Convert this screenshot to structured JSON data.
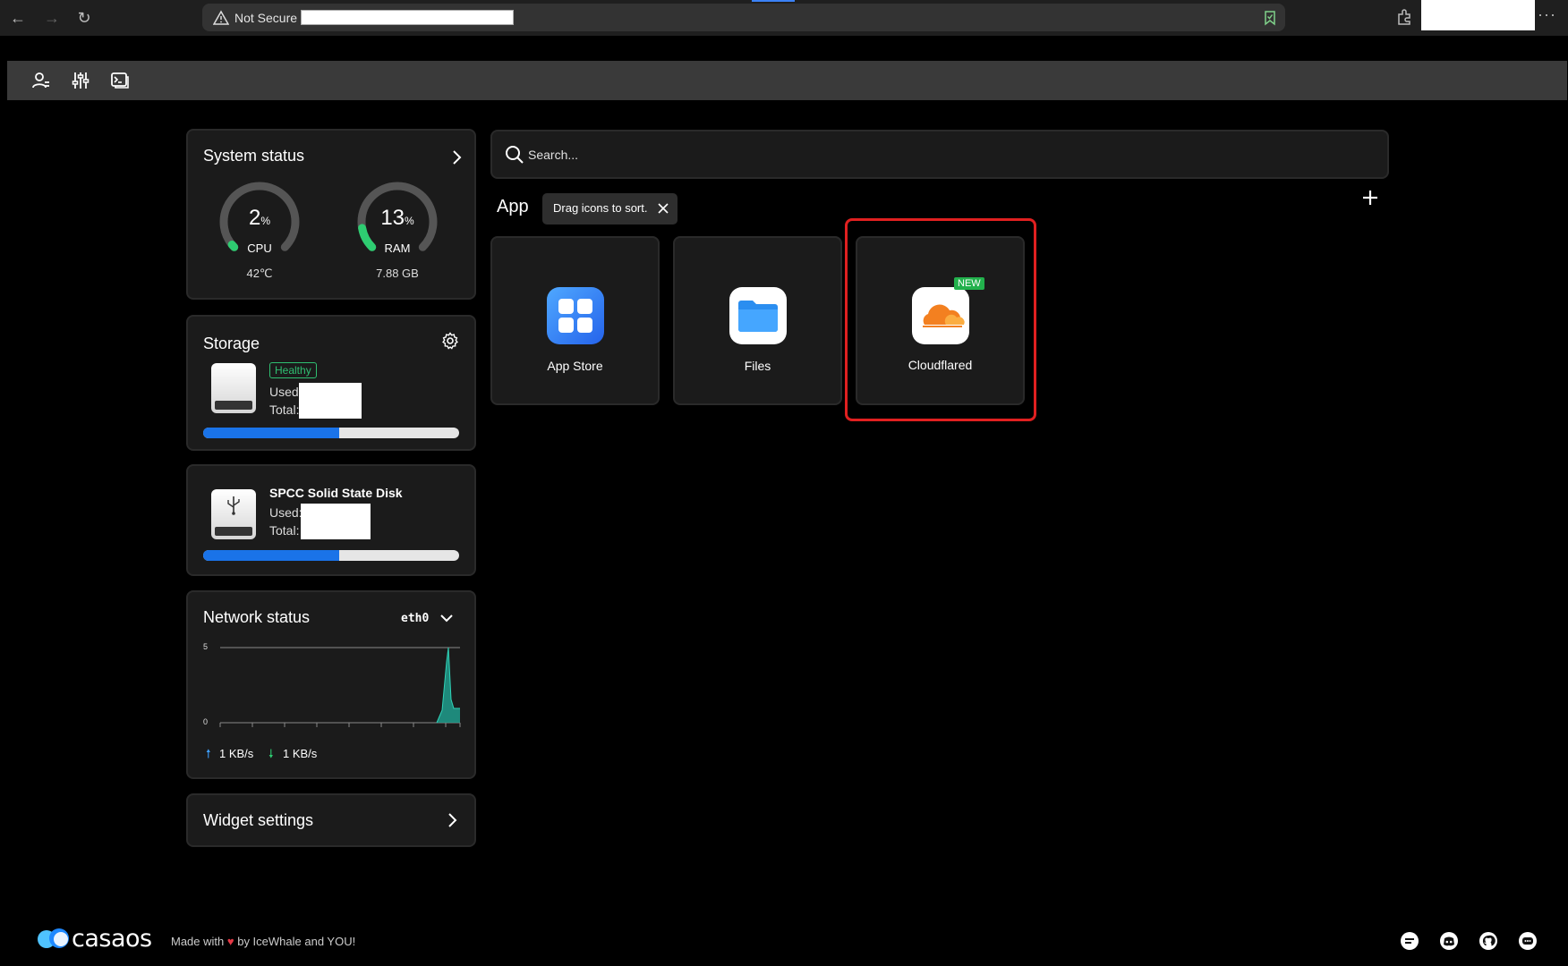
{
  "browser": {
    "security_label": "Not Secure",
    "nav": {
      "back": "←",
      "forward": "→",
      "reload": "↻"
    },
    "menu": "···"
  },
  "topbar": {
    "icons": [
      "user-settings-icon",
      "sliders-icon",
      "terminal-icon"
    ]
  },
  "system_status": {
    "title": "System status",
    "cpu": {
      "value": "2",
      "unit": "%",
      "label": "CPU",
      "sub": "42℃",
      "percent": 2
    },
    "ram": {
      "value": "13",
      "unit": "%",
      "label": "RAM",
      "sub": "7.88 GB",
      "percent": 13
    }
  },
  "storage": {
    "title": "Storage",
    "health": "Healthy",
    "used_label": "Used:",
    "total_label": "Total:",
    "usage_fraction": 0.53
  },
  "disk": {
    "name": "SPCC Solid State Disk",
    "used_label": "Used:",
    "total_label": "Total:",
    "usage_fraction": 0.53
  },
  "network": {
    "title": "Network status",
    "interface": "eth0",
    "y_max_label": "5",
    "y_min_label": "0",
    "upload": "1 KB/s",
    "download": "1 KB/s"
  },
  "widget_settings": {
    "title": "Widget settings"
  },
  "search": {
    "placeholder": "Search..."
  },
  "apps_section": {
    "title": "App",
    "tip": "Drag icons to sort.",
    "apps": [
      {
        "label": "App Store"
      },
      {
        "label": "Files"
      },
      {
        "label": "Cloudflared",
        "badge": "NEW"
      }
    ]
  },
  "footer": {
    "brand": "casaos",
    "made_with": "Made with",
    "by": "by IceWhale and YOU!",
    "icons": [
      "forum-icon",
      "discord-icon",
      "github-icon",
      "chat-icon"
    ]
  },
  "colors": {
    "accent": "#1a73e8",
    "highlight": "#e02020",
    "healthy": "#2fbf71",
    "gauge_fill": "#2ecc71"
  }
}
